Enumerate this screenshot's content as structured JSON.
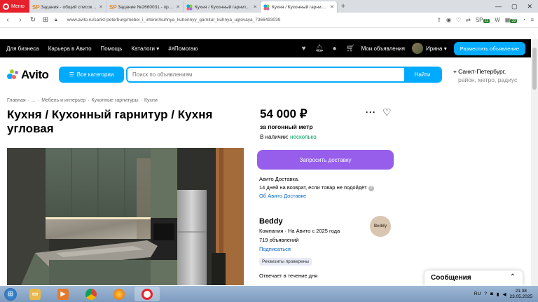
{
  "browser": {
    "menu_label": "Меню",
    "tabs": [
      {
        "icon": "SP",
        "title": "Задания - общий список ...",
        "active": false
      },
      {
        "icon": "SP",
        "title": "Задание №2660031 - про...",
        "active": false
      },
      {
        "icon": "avito",
        "title": "Кухня / Кухонный гарнит...",
        "active": false
      },
      {
        "icon": "avito",
        "title": "Кухня / Кухонный гарнитур",
        "active": true
      }
    ],
    "new_tab": "+",
    "url": "www.avito.ru/sankt-peterburg/mebel_i_interer/kuhnya_kuhonnyy_garnitur_kuhnya_uglovaya_7366493039",
    "ext_badge_1": "11",
    "ext_badge_2": "33"
  },
  "avito_top": {
    "links": [
      "Для бизнеса",
      "Карьера в Авито",
      "Помощь",
      "Каталоги ▾",
      "#яПомогаю"
    ],
    "my_ads": "Мои объявления",
    "user_name": "Ирина ▾",
    "post_button": "Разместить объявление"
  },
  "search": {
    "logo_text": "Avito",
    "categories_button": "Все категории",
    "placeholder": "Поиск по объявлениям",
    "find_button": "Найти",
    "location_city": "Санкт-Петербург,",
    "location_sub": "район, метро, радиус"
  },
  "breadcrumbs": [
    "Главная",
    "·",
    "...",
    "·",
    "Мебель и интерьер",
    "·",
    "Кухонные гарнитуры",
    "·",
    "Кухни"
  ],
  "listing": {
    "title": "Кухня / Кухонный гарнитур / Кухня угловая",
    "price": "54 000 ₽",
    "price_unit": "за погонный метр",
    "availability_label": "В наличии:",
    "availability_value": "несколько",
    "delivery_button": "Запросить доставку",
    "delivery_line1": "Авито Доставка.",
    "delivery_line2": "14 дней на возврат, если товар не подойдёт",
    "delivery_link": "Об Авито Доставке"
  },
  "seller": {
    "name": "Beddy",
    "info": "Компания · На Авито с 2025 года",
    "ads_count": "719 объявлений",
    "subscribe": "Подписаться",
    "logo_text": "Beddy",
    "verified": "Реквизиты проверены",
    "response": "Отвечает в течение дня"
  },
  "messages_widget": {
    "label": "Сообщения",
    "chevron": "⌃"
  },
  "taskbar": {
    "lang": "RU",
    "time": "21:38",
    "date": "23.05.2025"
  },
  "colors": {
    "avito_blue": "#00aaff",
    "delivery_purple": "#965eeb",
    "green": "#02a35b",
    "opera_red": "#e6212b"
  }
}
